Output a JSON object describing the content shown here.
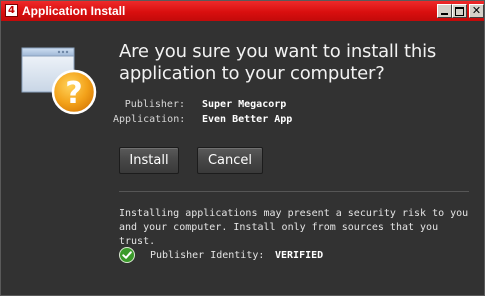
{
  "window": {
    "title": "Application Install",
    "app_icon_glyph": "4",
    "controls": {
      "minimize_icon": "minimize-icon",
      "maximize_icon": "maximize-icon",
      "close_icon": "close-icon"
    }
  },
  "prompt": {
    "question": "Are you sure you want to install this application to your computer?",
    "publisher_label": "Publisher:",
    "publisher_value": "Super Megacorp",
    "application_label": "Application:",
    "application_value": "Even Better App"
  },
  "actions": {
    "install_label": "Install",
    "cancel_label": "Cancel"
  },
  "security": {
    "warning": "Installing applications may present a security risk to you and your computer. Install only from sources that you trust.",
    "identity_label": "Publisher Identity:",
    "identity_value": "VERIFIED",
    "identity_icon": "check-icon"
  },
  "colors": {
    "titlebar": "#d90f0f",
    "background": "#323232",
    "verified_green": "#3a9a2a",
    "question_badge": "#f3a21a"
  }
}
